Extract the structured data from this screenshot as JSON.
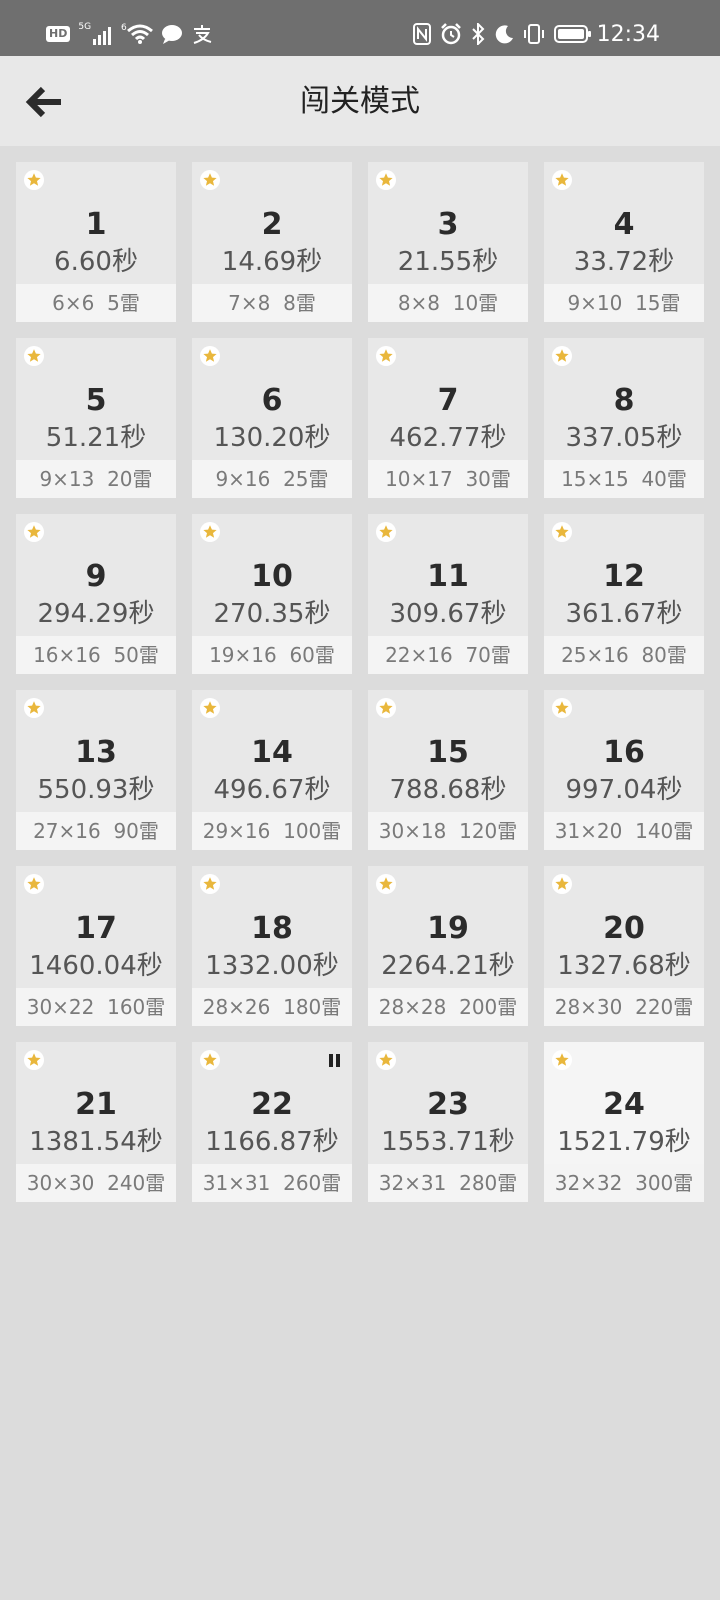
{
  "status_bar": {
    "hd": "HD",
    "network": "5G",
    "wifi_sup": "6",
    "time": "12:34",
    "left_icons": [
      "signal-icon",
      "wifi-icon",
      "chat-icon",
      "alipay-icon"
    ],
    "right_icons": [
      "nfc-icon",
      "alarm-icon",
      "bluetooth-icon",
      "moon-icon",
      "vibrate-icon",
      "battery-icon"
    ]
  },
  "header": {
    "title": "闯关模式",
    "back_icon": "arrow-left-icon"
  },
  "colors": {
    "star": "#e9b73c",
    "card": "#e8e8e8",
    "card_active": "#f5f5f5",
    "background": "#dcdcdc"
  },
  "levels": [
    {
      "num": "1",
      "time": "6.60秒",
      "info": "6×6  5雷"
    },
    {
      "num": "2",
      "time": "14.69秒",
      "info": "7×8  8雷"
    },
    {
      "num": "3",
      "time": "21.55秒",
      "info": "8×8  10雷"
    },
    {
      "num": "4",
      "time": "33.72秒",
      "info": "9×10  15雷"
    },
    {
      "num": "5",
      "time": "51.21秒",
      "info": "9×13  20雷"
    },
    {
      "num": "6",
      "time": "130.20秒",
      "info": "9×16  25雷"
    },
    {
      "num": "7",
      "time": "462.77秒",
      "info": "10×17  30雷"
    },
    {
      "num": "8",
      "time": "337.05秒",
      "info": "15×15  40雷"
    },
    {
      "num": "9",
      "time": "294.29秒",
      "info": "16×16  50雷"
    },
    {
      "num": "10",
      "time": "270.35秒",
      "info": "19×16  60雷"
    },
    {
      "num": "11",
      "time": "309.67秒",
      "info": "22×16  70雷"
    },
    {
      "num": "12",
      "time": "361.67秒",
      "info": "25×16  80雷"
    },
    {
      "num": "13",
      "time": "550.93秒",
      "info": "27×16  90雷"
    },
    {
      "num": "14",
      "time": "496.67秒",
      "info": "29×16  100雷"
    },
    {
      "num": "15",
      "time": "788.68秒",
      "info": "30×18  120雷"
    },
    {
      "num": "16",
      "time": "997.04秒",
      "info": "31×20  140雷"
    },
    {
      "num": "17",
      "time": "1460.04秒",
      "info": "30×22  160雷"
    },
    {
      "num": "18",
      "time": "1332.00秒",
      "info": "28×26  180雷"
    },
    {
      "num": "19",
      "time": "2264.21秒",
      "info": "28×28  200雷"
    },
    {
      "num": "20",
      "time": "1327.68秒",
      "info": "28×30  220雷"
    },
    {
      "num": "21",
      "time": "1381.54秒",
      "info": "30×30  240雷"
    },
    {
      "num": "22",
      "time": "1166.87秒",
      "info": "31×31  260雷"
    },
    {
      "num": "23",
      "time": "1553.71秒",
      "info": "32×31  280雷"
    },
    {
      "num": "24",
      "time": "1521.79秒",
      "info": "32×32  300雷"
    }
  ]
}
